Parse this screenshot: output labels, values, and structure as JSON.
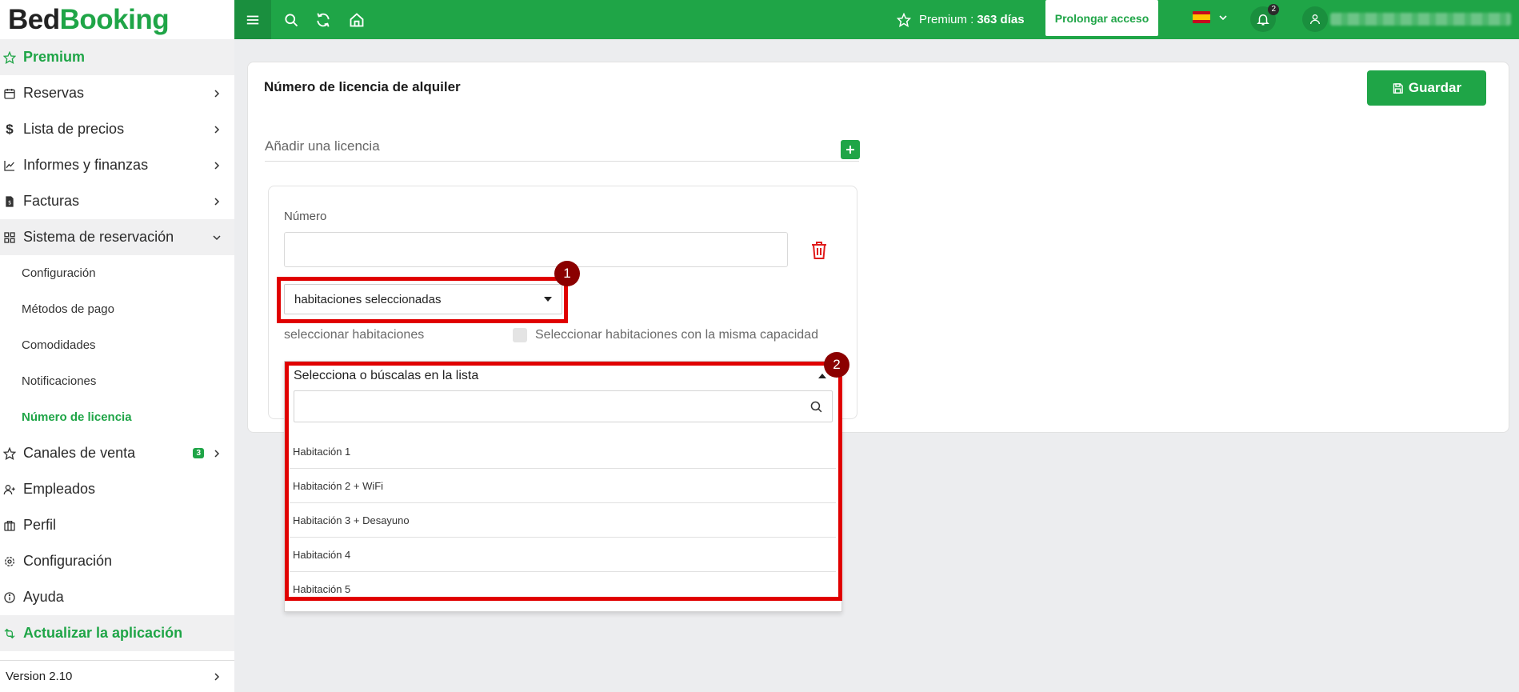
{
  "logo": {
    "part1": "Bed",
    "part2": "Booking"
  },
  "sidebar": {
    "items": [
      {
        "label": "Premium",
        "icon": "star-icon"
      },
      {
        "label": "Reservas",
        "icon": "calendar-icon"
      },
      {
        "label": "Lista de precios",
        "icon": "dollar-icon"
      },
      {
        "label": "Informes y finanzas",
        "icon": "chart-icon"
      },
      {
        "label": "Facturas",
        "icon": "invoice-icon"
      },
      {
        "label": "Sistema de reservación",
        "icon": "grid-icon"
      }
    ],
    "subitems": [
      {
        "label": "Configuración"
      },
      {
        "label": "Métodos de pago"
      },
      {
        "label": "Comodidades"
      },
      {
        "label": "Notificaciones"
      },
      {
        "label": "Número de licencia"
      }
    ],
    "items2": [
      {
        "label": "Canales de venta",
        "badge": "3",
        "icon": "star-icon"
      },
      {
        "label": "Empleados",
        "icon": "user-plus-icon"
      },
      {
        "label": "Perfil",
        "icon": "briefcase-icon"
      },
      {
        "label": "Configuración",
        "icon": "gear-icon"
      },
      {
        "label": "Ayuda",
        "icon": "info-icon"
      },
      {
        "label": "Actualizar la aplicación",
        "icon": "refresh-icon"
      }
    ],
    "version": "Version 2.10"
  },
  "topbar": {
    "premium_label": "Premium :",
    "premium_days": "363 días",
    "extend_button": "Prolongar acceso",
    "notification_count": "2",
    "language": "es"
  },
  "main": {
    "title": "Número de licencia de alquiler",
    "save_button": "Guardar",
    "add_license_label": "Añadir una licencia",
    "license": {
      "number_label": "Número",
      "number_value": "",
      "room_mode_selected": "habitaciones seleccionadas",
      "select_rooms_label": "seleccionar habitaciones",
      "same_capacity_label": "Seleccionar habitaciones con la misma capacidad",
      "same_capacity_checked": false,
      "rooms_placeholder": "Selecciona o búscalas en la lista",
      "search_value": "",
      "room_options": [
        "Habitación 1",
        "Habitación 2 + WiFi",
        "Habitación 3 + Desayuno",
        "Habitación 4",
        "Habitación 5"
      ]
    }
  },
  "annotations": {
    "marker1": "1",
    "marker2": "2"
  },
  "colors": {
    "brand_green": "#1fa547",
    "annotation_red": "#e00000",
    "marker_red": "#8b0000"
  }
}
